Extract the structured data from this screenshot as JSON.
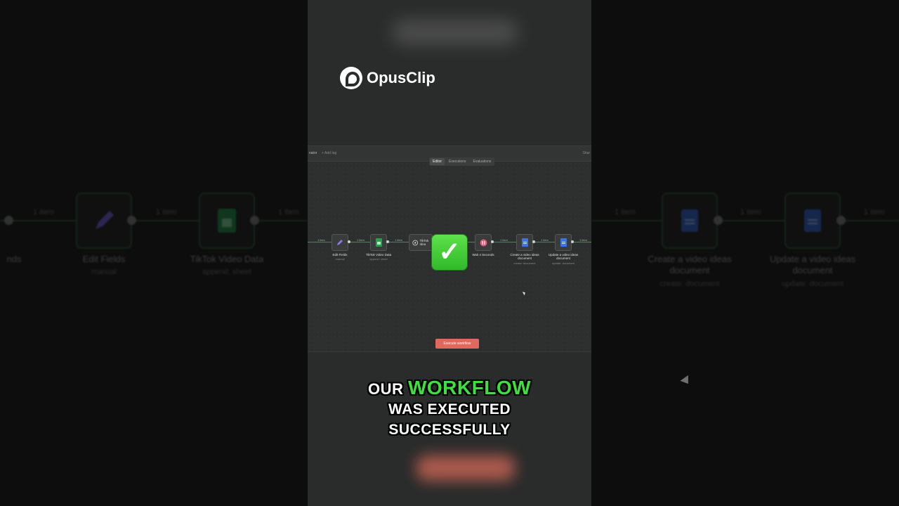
{
  "brand": {
    "name": "OpusClip"
  },
  "editor": {
    "title": "nator",
    "add_tag": "+ Add tag",
    "share": "Shar",
    "tabs": [
      "Editor",
      "Executions",
      "Evaluations"
    ],
    "execute_button": "Execute workflow"
  },
  "workflow_nodes": [
    {
      "label": "Edit Fields",
      "sub": "manual",
      "icon": "pencil-icon"
    },
    {
      "label": "TikTok Video Data",
      "sub": "append: sheet",
      "icon": "sheets-icon"
    },
    {
      "label": "TikTok Idea",
      "sub": "",
      "icon": "openai-icon"
    },
    {
      "label": "Wait 4 Seconds",
      "sub": "",
      "icon": "pause-icon"
    },
    {
      "label": "Create a video ideas document",
      "sub": "create: document",
      "icon": "docs-icon"
    },
    {
      "label": "Update a video ideas document",
      "sub": "update: document",
      "icon": "docs-icon"
    }
  ],
  "connector_label": "1 item",
  "side_left": {
    "partial_label": "nds",
    "edit_fields": "Edit Fields",
    "edit_fields_sub": "manual",
    "tiktok": "TikTok Video Data",
    "tiktok_sub": "append: sheet"
  },
  "side_right": {
    "create": "Create a video ideas document",
    "create_sub": "create: document",
    "update": "Update a video ideas document",
    "update_sub": "update: document"
  },
  "caption": {
    "word1": "OUR",
    "highlight": "WORKFLOW",
    "line2": "WAS EXECUTED",
    "line3": "SUCCESSFULLY"
  },
  "colors": {
    "highlight": "#3be23b",
    "execute": "#e2685d",
    "check": "#3fc93a"
  }
}
